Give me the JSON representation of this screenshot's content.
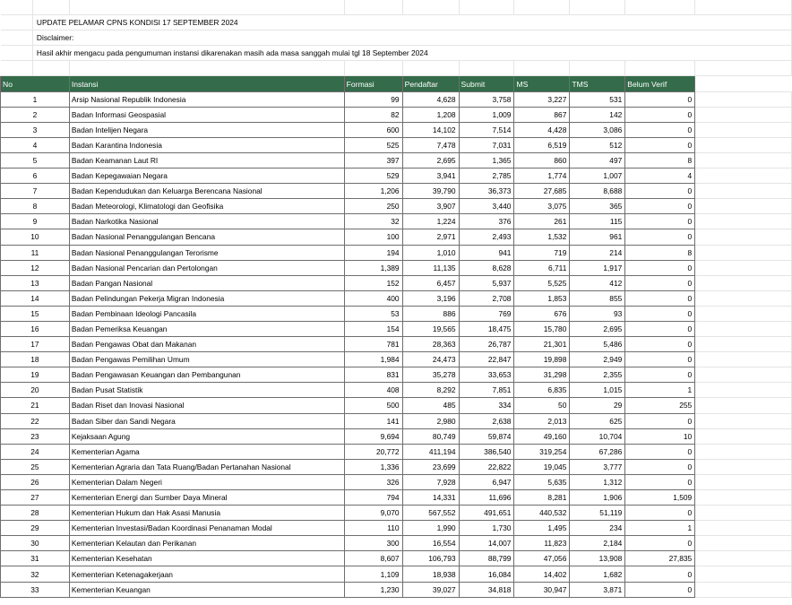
{
  "title": "UPDATE PELAMAR CPNS KONDISI 17 SEPTEMBER 2024",
  "disclaimer_label": "Disclaimer:",
  "disclaimer_text": "Hasil akhir mengacu pada pengumuman instansi dikarenakan masih ada masa sanggah mulai tgl 18 September 2024",
  "columns": [
    "No",
    "Instansi",
    "Formasi",
    "Pendaftar",
    "Submit",
    "MS",
    "TMS",
    "Belum Verif"
  ],
  "rows": [
    [
      "1",
      "Arsip Nasional Republik Indonesia",
      "99",
      "4,628",
      "3,758",
      "3,227",
      "531",
      "0"
    ],
    [
      "2",
      "Badan Informasi Geospasial",
      "82",
      "1,208",
      "1,009",
      "867",
      "142",
      "0"
    ],
    [
      "3",
      "Badan Intelijen Negara",
      "600",
      "14,102",
      "7,514",
      "4,428",
      "3,086",
      "0"
    ],
    [
      "4",
      "Badan Karantina Indonesia",
      "525",
      "7,478",
      "7,031",
      "6,519",
      "512",
      "0"
    ],
    [
      "5",
      "Badan Keamanan Laut RI",
      "397",
      "2,695",
      "1,365",
      "860",
      "497",
      "8"
    ],
    [
      "6",
      "Badan Kepegawaian Negara",
      "529",
      "3,941",
      "2,785",
      "1,774",
      "1,007",
      "4"
    ],
    [
      "7",
      "Badan Kependudukan dan Keluarga Berencana Nasional",
      "1,206",
      "39,790",
      "36,373",
      "27,685",
      "8,688",
      "0"
    ],
    [
      "8",
      "Badan Meteorologi, Klimatologi dan Geofisika",
      "250",
      "3,907",
      "3,440",
      "3,075",
      "365",
      "0"
    ],
    [
      "9",
      "Badan Narkotika Nasional",
      "32",
      "1,224",
      "376",
      "261",
      "115",
      "0"
    ],
    [
      "10",
      "Badan Nasional Penanggulangan Bencana",
      "100",
      "2,971",
      "2,493",
      "1,532",
      "961",
      "0"
    ],
    [
      "11",
      "Badan Nasional Penanggulangan Terorisme",
      "194",
      "1,010",
      "941",
      "719",
      "214",
      "8"
    ],
    [
      "12",
      "Badan Nasional Pencarian dan Pertolongan",
      "1,389",
      "11,135",
      "8,628",
      "6,711",
      "1,917",
      "0"
    ],
    [
      "13",
      "Badan Pangan Nasional",
      "152",
      "6,457",
      "5,937",
      "5,525",
      "412",
      "0"
    ],
    [
      "14",
      "Badan Pelindungan Pekerja Migran Indonesia",
      "400",
      "3,196",
      "2,708",
      "1,853",
      "855",
      "0"
    ],
    [
      "15",
      "Badan Pembinaan Ideologi Pancasila",
      "53",
      "886",
      "769",
      "676",
      "93",
      "0"
    ],
    [
      "16",
      "Badan Pemeriksa Keuangan",
      "154",
      "19,565",
      "18,475",
      "15,780",
      "2,695",
      "0"
    ],
    [
      "17",
      "Badan Pengawas Obat dan Makanan",
      "781",
      "28,363",
      "26,787",
      "21,301",
      "5,486",
      "0"
    ],
    [
      "18",
      "Badan Pengawas Pemilihan Umum",
      "1,984",
      "24,473",
      "22,847",
      "19,898",
      "2,949",
      "0"
    ],
    [
      "19",
      "Badan Pengawasan Keuangan dan Pembangunan",
      "831",
      "35,278",
      "33,653",
      "31,298",
      "2,355",
      "0"
    ],
    [
      "20",
      "Badan Pusat Statistik",
      "408",
      "8,292",
      "7,851",
      "6,835",
      "1,015",
      "1"
    ],
    [
      "21",
      "Badan Riset dan Inovasi Nasional",
      "500",
      "485",
      "334",
      "50",
      "29",
      "255"
    ],
    [
      "22",
      "Badan Siber dan Sandi Negara",
      "141",
      "2,980",
      "2,638",
      "2,013",
      "625",
      "0"
    ],
    [
      "23",
      "Kejaksaan Agung",
      "9,694",
      "80,749",
      "59,874",
      "49,160",
      "10,704",
      "10"
    ],
    [
      "24",
      "Kementerian Agama",
      "20,772",
      "411,194",
      "386,540",
      "319,254",
      "67,286",
      "0"
    ],
    [
      "25",
      "Kementerian Agraria dan Tata Ruang/Badan Pertanahan Nasional",
      "1,336",
      "23,699",
      "22,822",
      "19,045",
      "3,777",
      "0"
    ],
    [
      "26",
      "Kementerian Dalam Negeri",
      "326",
      "7,928",
      "6,947",
      "5,635",
      "1,312",
      "0"
    ],
    [
      "27",
      "Kementerian Energi dan Sumber Daya Mineral",
      "794",
      "14,331",
      "11,696",
      "8,281",
      "1,906",
      "1,509"
    ],
    [
      "28",
      "Kementerian Hukum dan Hak Asasi Manusia",
      "9,070",
      "567,552",
      "491,651",
      "440,532",
      "51,119",
      "0"
    ],
    [
      "29",
      "Kementerian Investasi/Badan Koordinasi Penanaman Modal",
      "110",
      "1,990",
      "1,730",
      "1,495",
      "234",
      "1"
    ],
    [
      "30",
      "Kementerian Kelautan dan Perikanan",
      "300",
      "16,554",
      "14,007",
      "11,823",
      "2,184",
      "0"
    ],
    [
      "31",
      "Kementerian Kesehatan",
      "8,607",
      "106,793",
      "88,799",
      "47,056",
      "13,908",
      "27,835"
    ],
    [
      "32",
      "Kementerian Ketenagakerjaan",
      "1,109",
      "18,938",
      "16,084",
      "14,402",
      "1,682",
      "0"
    ],
    [
      "33",
      "Kementerian Keuangan",
      "1,230",
      "39,027",
      "34,818",
      "30,947",
      "3,871",
      "0"
    ]
  ],
  "colors": {
    "header_bg": "#346b4a",
    "header_text": "#ffffff",
    "grid": "#e4e4e4",
    "border": "#6e6e6e"
  }
}
